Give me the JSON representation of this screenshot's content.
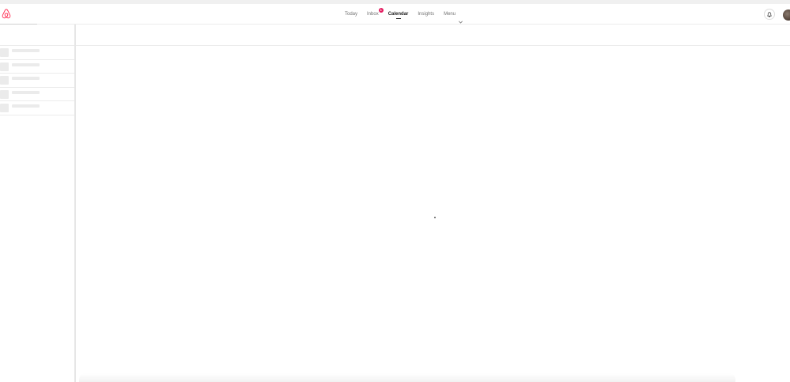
{
  "nav": {
    "today": "Today",
    "inbox": "Inbox",
    "inbox_badge": "1",
    "calendar": "Calendar",
    "insights": "Insights",
    "menu": "Menu"
  },
  "colors": {
    "brand": "#FF385C",
    "badge": "#E31C5F",
    "skeleton": "#EBEBEB"
  },
  "icons": {
    "logo": "airbnb-logo-icon",
    "notifications": "bell-icon",
    "menu_caret": "chevron-down-icon"
  },
  "sidebar": {
    "skeleton_rows": 5
  }
}
